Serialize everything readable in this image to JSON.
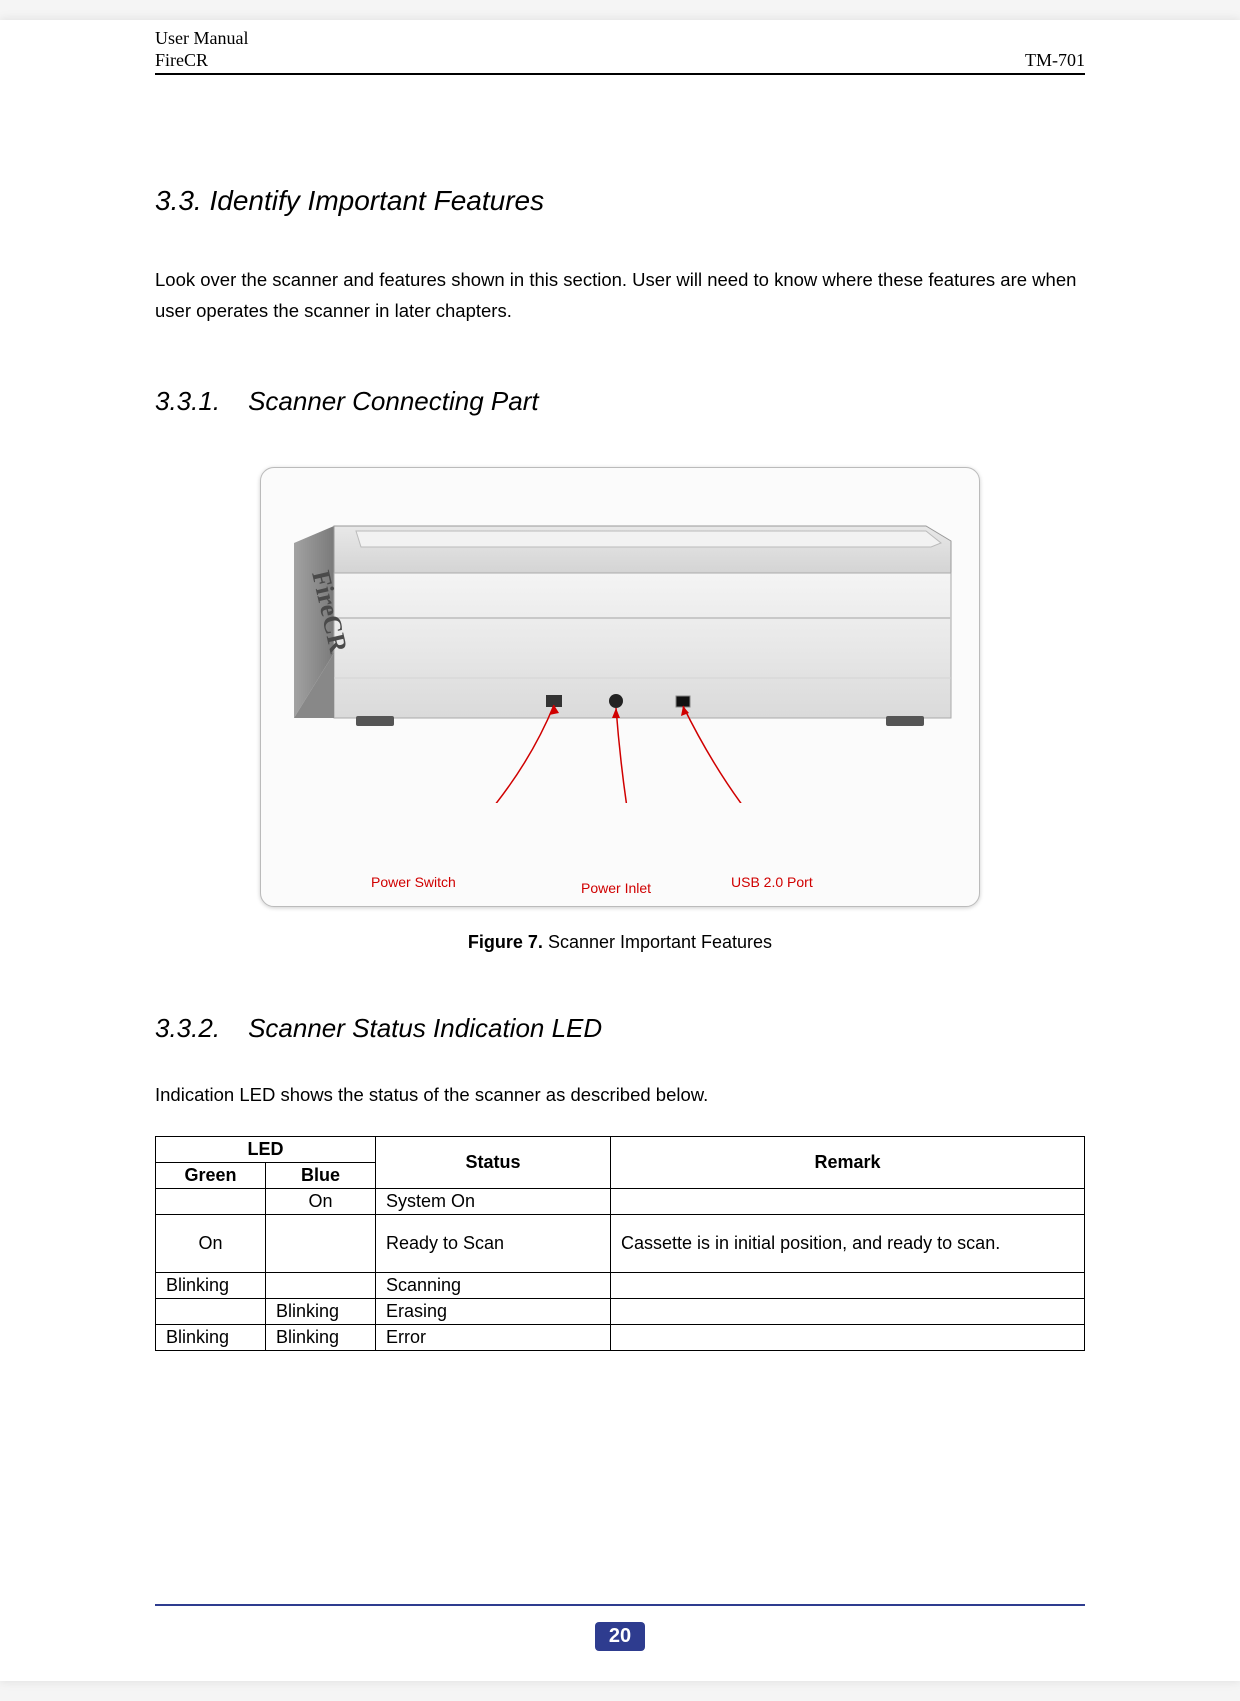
{
  "header": {
    "doc_type": "User Manual",
    "product": "FireCR",
    "doc_code": "TM-701"
  },
  "section": {
    "heading": "3.3.  Identify Important Features",
    "intro": "Look over the scanner and features shown in this section.   User will need to know where these features are when user operates the scanner in later chapters."
  },
  "sub1": {
    "num": "3.3.1.",
    "title": "Scanner Connecting Part",
    "callouts": {
      "power_switch": "Power Switch",
      "power_inlet": "Power Inlet",
      "usb_port": "USB 2.0 Port"
    },
    "caption_bold": "Figure 7.",
    "caption_rest": " Scanner Important Features"
  },
  "sub2": {
    "num": "3.3.2.",
    "title": "Scanner Status Indication LED",
    "intro": "Indication LED shows the status of the scanner as described below.",
    "table": {
      "head_led": "LED",
      "head_green": "Green",
      "head_blue": "Blue",
      "head_status": "Status",
      "head_remark": "Remark",
      "rows": [
        {
          "green": "",
          "blue": "On",
          "status": "System On",
          "remark": ""
        },
        {
          "green": "On",
          "blue": "",
          "status": "Ready to Scan",
          "remark": "Cassette is in initial position, and ready to scan."
        },
        {
          "green": "Blinking",
          "blue": "",
          "status": "Scanning",
          "remark": ""
        },
        {
          "green": "",
          "blue": "Blinking",
          "status": "Erasing",
          "remark": ""
        },
        {
          "green": "Blinking",
          "blue": "Blinking",
          "status": "Error",
          "remark": ""
        }
      ]
    }
  },
  "footer": {
    "page": "20"
  }
}
